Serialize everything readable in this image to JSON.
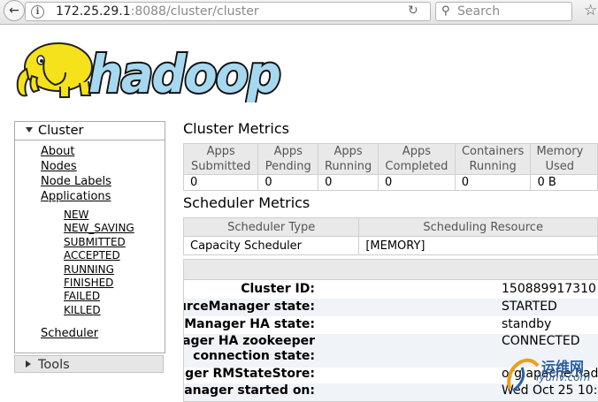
{
  "browser": {
    "url_host": "172.25.29.1",
    "url_rest": ":8088/cluster/cluster",
    "search_placeholder": "Search",
    "icons": {
      "back": "back-arrow-icon",
      "info": "info-icon",
      "reload": "reload-icon",
      "search": "search-icon",
      "bookmark": "bookmark-star-icon"
    }
  },
  "logo": {
    "text": "hadoop",
    "colors": {
      "text": "#000000",
      "text_fill": "#a6d8f0",
      "elephant": "#f5e21a"
    }
  },
  "nav": {
    "cluster_label": "Cluster",
    "links": {
      "about": "About",
      "nodes": "Nodes",
      "node_labels": "Node Labels",
      "applications": "Applications",
      "scheduler": "Scheduler"
    },
    "app_states": [
      "NEW",
      "NEW_SAVING",
      "SUBMITTED",
      "ACCEPTED",
      "RUNNING",
      "FINISHED",
      "FAILED",
      "KILLED"
    ],
    "tools_label": "Tools"
  },
  "cluster_metrics": {
    "title": "Cluster Metrics",
    "headers": [
      [
        "Apps",
        "Submitted"
      ],
      [
        "Apps",
        "Pending"
      ],
      [
        "Apps",
        "Running"
      ],
      [
        "Apps",
        "Completed"
      ],
      [
        "Containers",
        "Running"
      ],
      [
        "Memory",
        "Used"
      ]
    ],
    "values": [
      "0",
      "0",
      "0",
      "0",
      "0",
      "0 B"
    ]
  },
  "scheduler_metrics": {
    "title": "Scheduler Metrics",
    "headers": [
      "Scheduler Type",
      "Scheduling Resource"
    ],
    "values": [
      "Capacity Scheduler",
      "[MEMORY]"
    ]
  },
  "cluster_info": {
    "rows": [
      {
        "label": "Cluster ID:",
        "value": "150889917310"
      },
      {
        "label": "ResourceManager state:",
        "value": "STARTED"
      },
      {
        "label": "ResourceManager HA state:",
        "value": "standby"
      },
      {
        "label": "ResourceManager HA zookeeper",
        "label2": "connection state:",
        "value": "CONNECTED"
      },
      {
        "label": "ResourceManager RMStateStore:",
        "value": "org.apache.had"
      },
      {
        "label": "ResourceManager started on:",
        "value": "Wed Oct 25 10:"
      }
    ]
  },
  "watermark": {
    "line1": "运维网",
    "line2": "iyunv.com"
  }
}
